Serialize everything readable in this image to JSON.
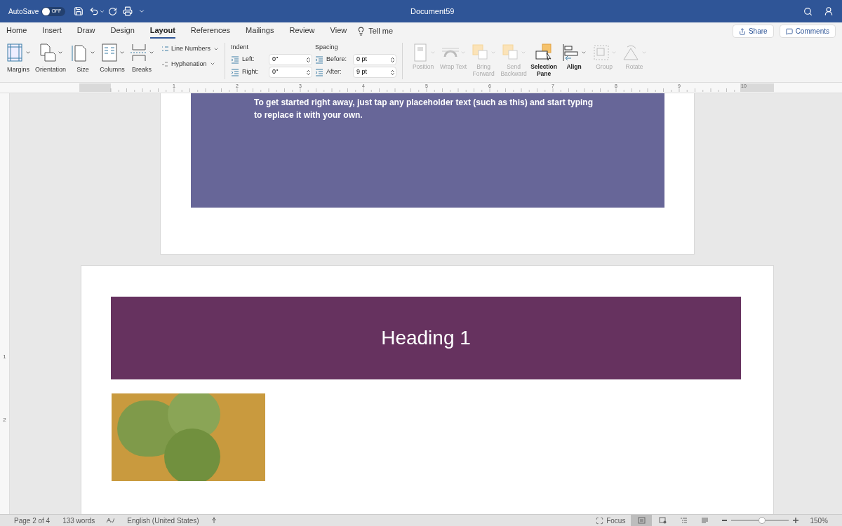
{
  "title_bar": {
    "autosave_label": "AutoSave",
    "autosave": {
      "on": false,
      "label": "OFF"
    },
    "title": "Document59"
  },
  "tabs": [
    {
      "label": "Home",
      "selected": false
    },
    {
      "label": "Insert",
      "selected": false
    },
    {
      "label": "Draw",
      "selected": false
    },
    {
      "label": "Design",
      "selected": false
    },
    {
      "label": "Layout",
      "selected": true
    },
    {
      "label": "References",
      "selected": false
    },
    {
      "label": "Mailings",
      "selected": false
    },
    {
      "label": "Review",
      "selected": false
    },
    {
      "label": "View",
      "selected": false
    }
  ],
  "tell_me": "Tell me",
  "share": "Share",
  "comments": "Comments",
  "page_setup": [
    {
      "kind": "margins",
      "label": "Margins"
    },
    {
      "kind": "orientation",
      "label": "Orientation"
    },
    {
      "kind": "size",
      "label": "Size"
    },
    {
      "kind": "columns",
      "label": "Columns"
    },
    {
      "kind": "breaks",
      "label": "Breaks"
    }
  ],
  "line_numbers": "Line Numbers",
  "hyphenation": "Hyphenation",
  "indent": {
    "title": "Indent",
    "left_label": "Left:",
    "left": "0\"",
    "right_label": "Right:",
    "right": "0\""
  },
  "spacing": {
    "title": "Spacing",
    "before_label": "Before:",
    "before": "0 pt",
    "after_label": "After:",
    "after": "9 pt"
  },
  "arrange": [
    {
      "kind": "position",
      "label": "Position",
      "disabled": true
    },
    {
      "kind": "wrap",
      "label": "Wrap Text",
      "disabled": true
    },
    {
      "kind": "forward",
      "label": "Bring Forward",
      "disabled": true
    },
    {
      "kind": "backward",
      "label": "Send Backward",
      "disabled": true
    },
    {
      "kind": "selection",
      "label": "Selection Pane",
      "disabled": false
    },
    {
      "kind": "align",
      "label": "Align",
      "disabled": false
    },
    {
      "kind": "group",
      "label": "Group",
      "disabled": true
    },
    {
      "kind": "rotate",
      "label": "Rotate",
      "disabled": true
    }
  ],
  "ruler": [
    "1",
    "2",
    "3",
    "4",
    "5",
    "6",
    "7",
    "8",
    "9",
    "10"
  ],
  "vertical_ruler": [
    "1",
    "2"
  ],
  "page_1": {
    "text": "To get started right away, just tap any placeholder text (such as this) and start typing to replace it with your own."
  },
  "page_2": {
    "heading": "Heading 1"
  },
  "status_bar": {
    "page": "Page 2 of 4",
    "words": "133 words",
    "language": "English (United States)",
    "focus": "Focus",
    "views": [
      {
        "kind": "print",
        "selected": true
      },
      {
        "kind": "web",
        "selected": false
      },
      {
        "kind": "outline",
        "selected": false
      },
      {
        "kind": "draft",
        "selected": false
      }
    ],
    "zoom": {
      "level": 0.53
    },
    "zoom_label": "150%"
  }
}
